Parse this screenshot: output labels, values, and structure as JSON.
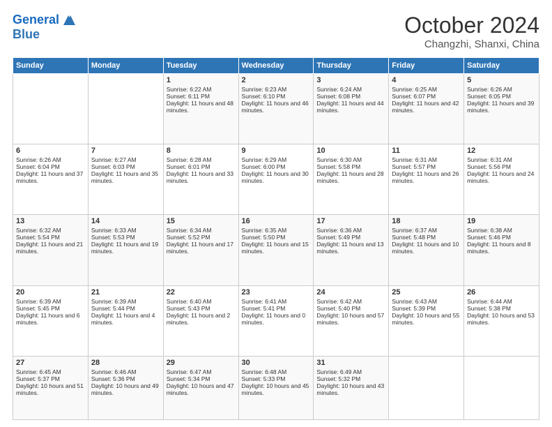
{
  "logo": {
    "line1": "General",
    "line2": "Blue"
  },
  "title": "October 2024",
  "location": "Changzhi, Shanxi, China",
  "days_of_week": [
    "Sunday",
    "Monday",
    "Tuesday",
    "Wednesday",
    "Thursday",
    "Friday",
    "Saturday"
  ],
  "weeks": [
    [
      {
        "day": "",
        "sunrise": "",
        "sunset": "",
        "daylight": ""
      },
      {
        "day": "",
        "sunrise": "",
        "sunset": "",
        "daylight": ""
      },
      {
        "day": "1",
        "sunrise": "Sunrise: 6:22 AM",
        "sunset": "Sunset: 6:11 PM",
        "daylight": "Daylight: 11 hours and 48 minutes."
      },
      {
        "day": "2",
        "sunrise": "Sunrise: 6:23 AM",
        "sunset": "Sunset: 6:10 PM",
        "daylight": "Daylight: 11 hours and 46 minutes."
      },
      {
        "day": "3",
        "sunrise": "Sunrise: 6:24 AM",
        "sunset": "Sunset: 6:08 PM",
        "daylight": "Daylight: 11 hours and 44 minutes."
      },
      {
        "day": "4",
        "sunrise": "Sunrise: 6:25 AM",
        "sunset": "Sunset: 6:07 PM",
        "daylight": "Daylight: 11 hours and 42 minutes."
      },
      {
        "day": "5",
        "sunrise": "Sunrise: 6:26 AM",
        "sunset": "Sunset: 6:05 PM",
        "daylight": "Daylight: 11 hours and 39 minutes."
      }
    ],
    [
      {
        "day": "6",
        "sunrise": "Sunrise: 6:26 AM",
        "sunset": "Sunset: 6:04 PM",
        "daylight": "Daylight: 11 hours and 37 minutes."
      },
      {
        "day": "7",
        "sunrise": "Sunrise: 6:27 AM",
        "sunset": "Sunset: 6:03 PM",
        "daylight": "Daylight: 11 hours and 35 minutes."
      },
      {
        "day": "8",
        "sunrise": "Sunrise: 6:28 AM",
        "sunset": "Sunset: 6:01 PM",
        "daylight": "Daylight: 11 hours and 33 minutes."
      },
      {
        "day": "9",
        "sunrise": "Sunrise: 6:29 AM",
        "sunset": "Sunset: 6:00 PM",
        "daylight": "Daylight: 11 hours and 30 minutes."
      },
      {
        "day": "10",
        "sunrise": "Sunrise: 6:30 AM",
        "sunset": "Sunset: 5:58 PM",
        "daylight": "Daylight: 11 hours and 28 minutes."
      },
      {
        "day": "11",
        "sunrise": "Sunrise: 6:31 AM",
        "sunset": "Sunset: 5:57 PM",
        "daylight": "Daylight: 11 hours and 26 minutes."
      },
      {
        "day": "12",
        "sunrise": "Sunrise: 6:31 AM",
        "sunset": "Sunset: 5:56 PM",
        "daylight": "Daylight: 11 hours and 24 minutes."
      }
    ],
    [
      {
        "day": "13",
        "sunrise": "Sunrise: 6:32 AM",
        "sunset": "Sunset: 5:54 PM",
        "daylight": "Daylight: 11 hours and 21 minutes."
      },
      {
        "day": "14",
        "sunrise": "Sunrise: 6:33 AM",
        "sunset": "Sunset: 5:53 PM",
        "daylight": "Daylight: 11 hours and 19 minutes."
      },
      {
        "day": "15",
        "sunrise": "Sunrise: 6:34 AM",
        "sunset": "Sunset: 5:52 PM",
        "daylight": "Daylight: 11 hours and 17 minutes."
      },
      {
        "day": "16",
        "sunrise": "Sunrise: 6:35 AM",
        "sunset": "Sunset: 5:50 PM",
        "daylight": "Daylight: 11 hours and 15 minutes."
      },
      {
        "day": "17",
        "sunrise": "Sunrise: 6:36 AM",
        "sunset": "Sunset: 5:49 PM",
        "daylight": "Daylight: 11 hours and 13 minutes."
      },
      {
        "day": "18",
        "sunrise": "Sunrise: 6:37 AM",
        "sunset": "Sunset: 5:48 PM",
        "daylight": "Daylight: 11 hours and 10 minutes."
      },
      {
        "day": "19",
        "sunrise": "Sunrise: 6:38 AM",
        "sunset": "Sunset: 5:46 PM",
        "daylight": "Daylight: 11 hours and 8 minutes."
      }
    ],
    [
      {
        "day": "20",
        "sunrise": "Sunrise: 6:39 AM",
        "sunset": "Sunset: 5:45 PM",
        "daylight": "Daylight: 11 hours and 6 minutes."
      },
      {
        "day": "21",
        "sunrise": "Sunrise: 6:39 AM",
        "sunset": "Sunset: 5:44 PM",
        "daylight": "Daylight: 11 hours and 4 minutes."
      },
      {
        "day": "22",
        "sunrise": "Sunrise: 6:40 AM",
        "sunset": "Sunset: 5:43 PM",
        "daylight": "Daylight: 11 hours and 2 minutes."
      },
      {
        "day": "23",
        "sunrise": "Sunrise: 6:41 AM",
        "sunset": "Sunset: 5:41 PM",
        "daylight": "Daylight: 11 hours and 0 minutes."
      },
      {
        "day": "24",
        "sunrise": "Sunrise: 6:42 AM",
        "sunset": "Sunset: 5:40 PM",
        "daylight": "Daylight: 10 hours and 57 minutes."
      },
      {
        "day": "25",
        "sunrise": "Sunrise: 6:43 AM",
        "sunset": "Sunset: 5:39 PM",
        "daylight": "Daylight: 10 hours and 55 minutes."
      },
      {
        "day": "26",
        "sunrise": "Sunrise: 6:44 AM",
        "sunset": "Sunset: 5:38 PM",
        "daylight": "Daylight: 10 hours and 53 minutes."
      }
    ],
    [
      {
        "day": "27",
        "sunrise": "Sunrise: 6:45 AM",
        "sunset": "Sunset: 5:37 PM",
        "daylight": "Daylight: 10 hours and 51 minutes."
      },
      {
        "day": "28",
        "sunrise": "Sunrise: 6:46 AM",
        "sunset": "Sunset: 5:36 PM",
        "daylight": "Daylight: 10 hours and 49 minutes."
      },
      {
        "day": "29",
        "sunrise": "Sunrise: 6:47 AM",
        "sunset": "Sunset: 5:34 PM",
        "daylight": "Daylight: 10 hours and 47 minutes."
      },
      {
        "day": "30",
        "sunrise": "Sunrise: 6:48 AM",
        "sunset": "Sunset: 5:33 PM",
        "daylight": "Daylight: 10 hours and 45 minutes."
      },
      {
        "day": "31",
        "sunrise": "Sunrise: 6:49 AM",
        "sunset": "Sunset: 5:32 PM",
        "daylight": "Daylight: 10 hours and 43 minutes."
      },
      {
        "day": "",
        "sunrise": "",
        "sunset": "",
        "daylight": ""
      },
      {
        "day": "",
        "sunrise": "",
        "sunset": "",
        "daylight": ""
      }
    ]
  ]
}
